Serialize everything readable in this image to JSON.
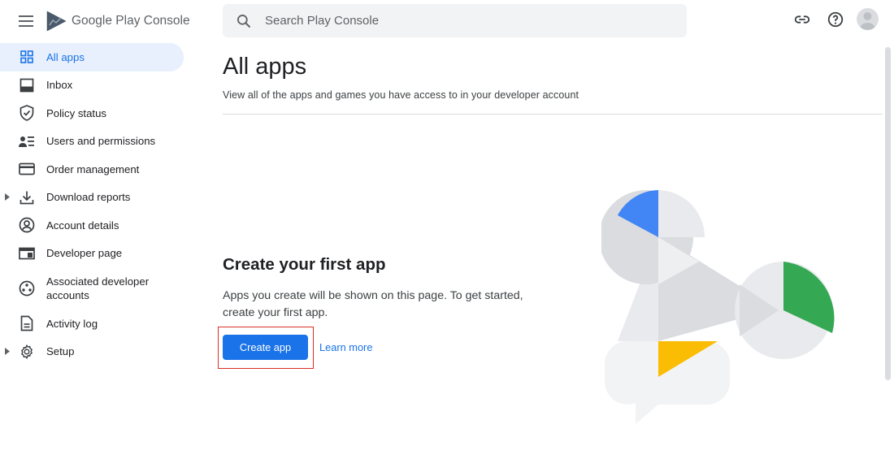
{
  "header": {
    "logo_text": "Google Play Console",
    "search_placeholder": "Search Play Console"
  },
  "sidebar": {
    "items": [
      {
        "label": "All apps",
        "icon": "grid-icon",
        "active": true
      },
      {
        "label": "Inbox",
        "icon": "inbox-icon"
      },
      {
        "label": "Policy status",
        "icon": "shield-check-icon"
      },
      {
        "label": "Users and permissions",
        "icon": "people-list-icon"
      },
      {
        "label": "Order management",
        "icon": "credit-card-icon"
      },
      {
        "label": "Download reports",
        "icon": "download-icon",
        "expandable": true
      },
      {
        "label": "Account details",
        "icon": "account-circle-icon"
      },
      {
        "label": "Developer page",
        "icon": "web-page-icon"
      },
      {
        "label": "Associated developer accounts",
        "icon": "workspaces-icon"
      },
      {
        "label": "Activity log",
        "icon": "document-icon"
      },
      {
        "label": "Setup",
        "icon": "gear-icon",
        "expandable": true
      }
    ]
  },
  "main": {
    "title": "All apps",
    "subtitle": "View all of the apps and games you have access to in your developer account",
    "empty_state": {
      "title": "Create your first app",
      "description": "Apps you create will be shown on this page. To get started, create your first app.",
      "primary_button": "Create app",
      "secondary_link": "Learn more"
    }
  },
  "colors": {
    "accent": "#1a73e8",
    "active_bg": "#e8f0fe",
    "highlight_outline": "#d93025",
    "illustration_blue": "#4285f4",
    "illustration_green": "#34a853",
    "illustration_yellow": "#fbbc04",
    "illustration_gray": "#dadce0"
  }
}
